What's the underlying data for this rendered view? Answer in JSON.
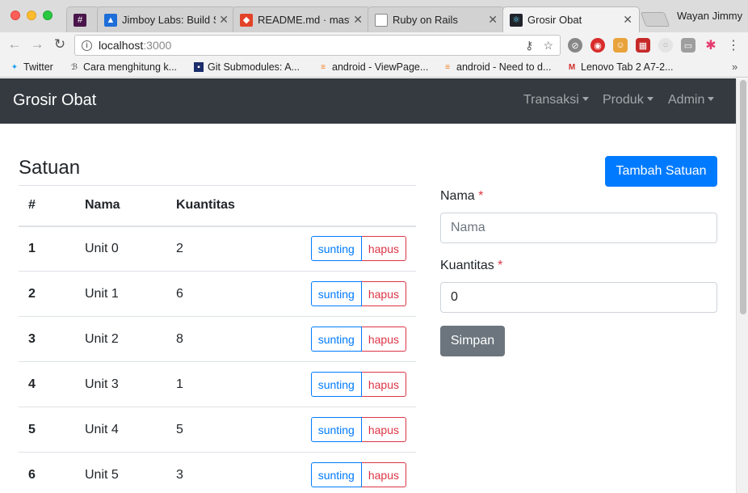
{
  "browser": {
    "tabs": [
      {
        "label": "",
        "icon": "slack-hash-icon",
        "color": "#4a154b"
      },
      {
        "label": "Jimboy Labs: Build S",
        "icon": "jimboy-logo-icon",
        "color": "#1d6ed8"
      },
      {
        "label": "README.md · maste",
        "icon": "gitlab-fox-icon",
        "color": "#e24329"
      },
      {
        "label": "Ruby on Rails",
        "icon": "document-icon",
        "color": "#777777"
      },
      {
        "label": "Grosir Obat",
        "icon": "react-atom-icon",
        "color": "#20232a"
      }
    ],
    "profile": "Wayan Jimmy",
    "url_host": "localhost",
    "url_port": ":3000",
    "bookmarks": [
      {
        "label": "Twitter",
        "icon": "twitter-icon"
      },
      {
        "label": "Cara menghitung k...",
        "icon": "b-logo-icon"
      },
      {
        "label": "Git Submodules: A...",
        "icon": "gitsub-icon"
      },
      {
        "label": "android - ViewPage...",
        "icon": "stackoverflow-icon"
      },
      {
        "label": "android - Need to d...",
        "icon": "stackoverflow-icon"
      },
      {
        "label": "Lenovo Tab 2 A7-2...",
        "icon": "m-logo-icon"
      }
    ]
  },
  "navbar": {
    "brand": "Grosir Obat",
    "menus": [
      "Transaksi",
      "Produk",
      "Admin"
    ]
  },
  "page": {
    "title": "Satuan",
    "add_button": "Tambah Satuan",
    "table": {
      "headers": [
        "#",
        "Nama",
        "Kuantitas",
        ""
      ],
      "rows": [
        {
          "id": "1",
          "nama": "Unit 0",
          "kuantitas": "2"
        },
        {
          "id": "2",
          "nama": "Unit 1",
          "kuantitas": "6"
        },
        {
          "id": "3",
          "nama": "Unit 2",
          "kuantitas": "8"
        },
        {
          "id": "4",
          "nama": "Unit 3",
          "kuantitas": "1"
        },
        {
          "id": "5",
          "nama": "Unit 4",
          "kuantitas": "5"
        },
        {
          "id": "6",
          "nama": "Unit 5",
          "kuantitas": "3"
        }
      ],
      "edit_label": "sunting",
      "delete_label": "hapus"
    },
    "form": {
      "nama_label": "Nama",
      "nama_placeholder": "Nama",
      "kuantitas_label": "Kuantitas",
      "kuantitas_value": "0",
      "required_mark": "*",
      "submit_label": "Simpan"
    }
  },
  "colors": {
    "primary": "#007bff",
    "danger": "#dc3545",
    "secondary": "#6c757d",
    "navbar": "#343a40"
  }
}
